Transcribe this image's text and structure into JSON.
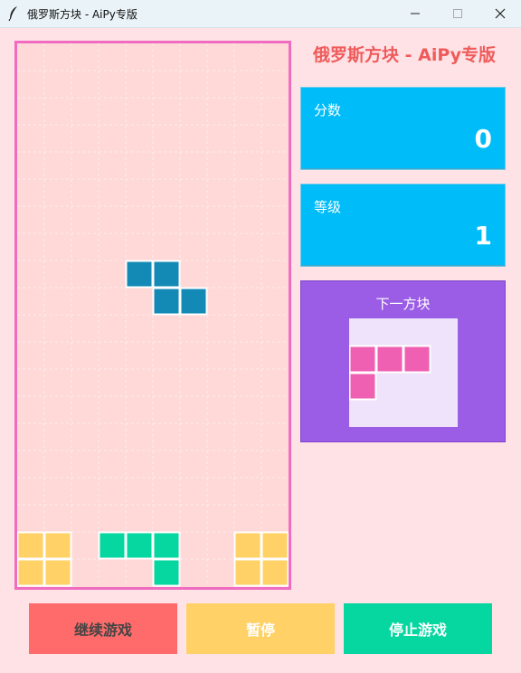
{
  "window": {
    "title": "俄罗斯方块 - AiPy专版",
    "icons": [
      "feather-icon",
      "minimize-icon",
      "maximize-icon",
      "close-icon"
    ]
  },
  "game": {
    "title": "俄罗斯方块 - AiPy专版",
    "score_label": "分数",
    "score_value": "0",
    "level_label": "等级",
    "level_value": "1",
    "next_label": "下一方块"
  },
  "board": {
    "columns": 10,
    "rows": 20,
    "background": "#ffd8d8",
    "border_color": "#f06cc0",
    "active_piece": {
      "color": "#138ab6",
      "cells": [
        [
          4,
          8
        ],
        [
          5,
          8
        ],
        [
          5,
          9
        ],
        [
          6,
          9
        ]
      ]
    },
    "locked_cells": [
      {
        "color": "#ffd166",
        "cells": [
          [
            0,
            18
          ],
          [
            1,
            18
          ],
          [
            0,
            19
          ],
          [
            1,
            19
          ],
          [
            8,
            18
          ],
          [
            9,
            18
          ],
          [
            8,
            19
          ],
          [
            9,
            19
          ]
        ]
      },
      {
        "color": "#06d6a0",
        "cells": [
          [
            3,
            18
          ],
          [
            4,
            18
          ],
          [
            5,
            18
          ],
          [
            5,
            19
          ]
        ]
      }
    ]
  },
  "next_piece": {
    "color": "#ef5fb2",
    "cells": [
      [
        0,
        0
      ],
      [
        1,
        0
      ],
      [
        2,
        0
      ],
      [
        0,
        1
      ]
    ]
  },
  "buttons": {
    "resume": "继续游戏",
    "pause": "暂停",
    "stop": "停止游戏"
  },
  "colors": {
    "stat_box": "#00bdf9",
    "next_box": "#9b5de5",
    "title": "#ef5b5b"
  }
}
